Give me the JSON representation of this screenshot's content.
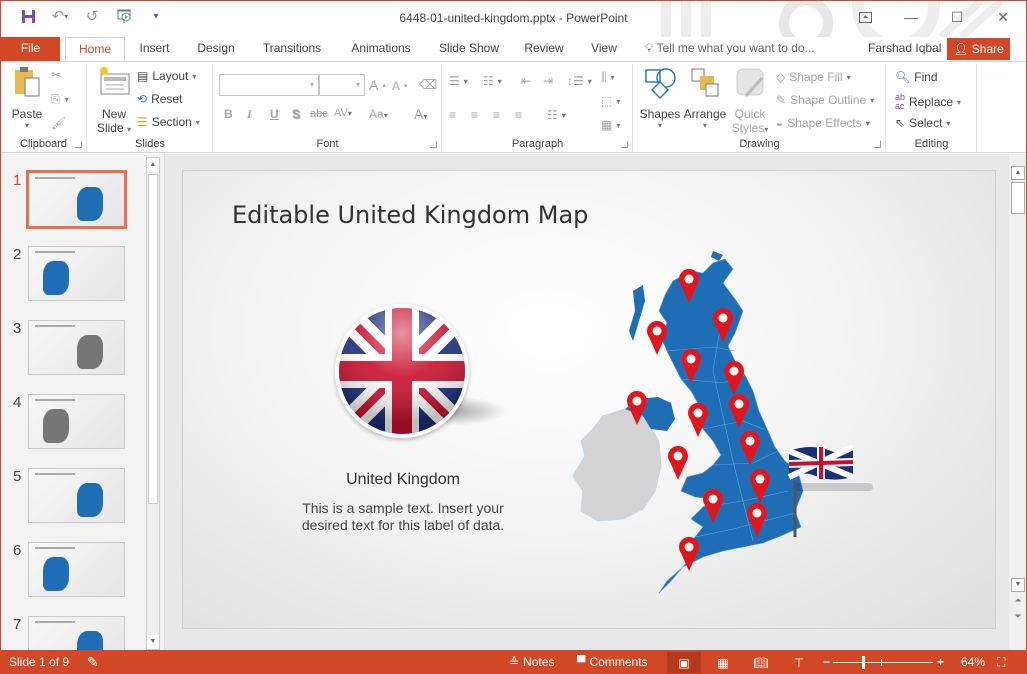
{
  "window": {
    "title": "6448-01-united-kingdom.pptx - PowerPoint",
    "qat": [
      "save-icon",
      "undo-icon",
      "redo-icon",
      "start-slideshow-icon",
      "customize-qat-icon"
    ],
    "controls": [
      "ribbon-display-options-icon",
      "minimize-icon",
      "maximize-icon",
      "close-icon"
    ]
  },
  "tabs": {
    "file": "File",
    "items": [
      "Home",
      "Insert",
      "Design",
      "Transitions",
      "Animations",
      "Slide Show",
      "Review",
      "View"
    ],
    "active": "Home",
    "tell_me": "Tell me what you want to do...",
    "user": "Farshad Iqbal",
    "share": "Share"
  },
  "ribbon": {
    "clipboard": {
      "label": "Clipboard",
      "paste": "Paste"
    },
    "slides": {
      "label": "Slides",
      "new_slide_1": "New",
      "new_slide_2": "Slide",
      "layout": "Layout",
      "reset": "Reset",
      "section": "Section"
    },
    "font": {
      "label": "Font",
      "font_name": "",
      "font_size": "",
      "bold": "B",
      "italic": "I",
      "underline": "U",
      "shadow": "S",
      "strike": "abc",
      "spacing": "AV",
      "case": "Aa",
      "color": "A"
    },
    "paragraph": {
      "label": "Paragraph"
    },
    "drawing": {
      "label": "Drawing",
      "shapes": "Shapes",
      "arrange": "Arrange",
      "quick_1": "Quick",
      "quick_2": "Styles",
      "shape_fill": "Shape Fill",
      "shape_outline": "Shape Outline",
      "shape_effects": "Shape Effects"
    },
    "editing": {
      "label": "Editing",
      "find": "Find",
      "replace": "Replace",
      "select": "Select"
    }
  },
  "thumbnails": [
    {
      "num": "1",
      "active": true
    },
    {
      "num": "2",
      "active": false
    },
    {
      "num": "3",
      "active": false
    },
    {
      "num": "4",
      "active": false
    },
    {
      "num": "5",
      "active": false
    },
    {
      "num": "6",
      "active": false
    },
    {
      "num": "7",
      "active": false
    }
  ],
  "slide": {
    "title": "Editable United Kingdom Map",
    "country_label": "United Kingdom",
    "description": "This is a sample text. Insert your desired text for this label of data.",
    "map_pin_count": 14
  },
  "status": {
    "slide_info": "Slide 1 of 9",
    "notes": "Notes",
    "comments": "Comments",
    "zoom": "64%",
    "zoom_level_percent": 64
  },
  "colors": {
    "accent": "#d24726",
    "map_blue": "#1f6db5",
    "ireland_gray": "#d4d4d4",
    "pin_red": "#e3151c"
  }
}
